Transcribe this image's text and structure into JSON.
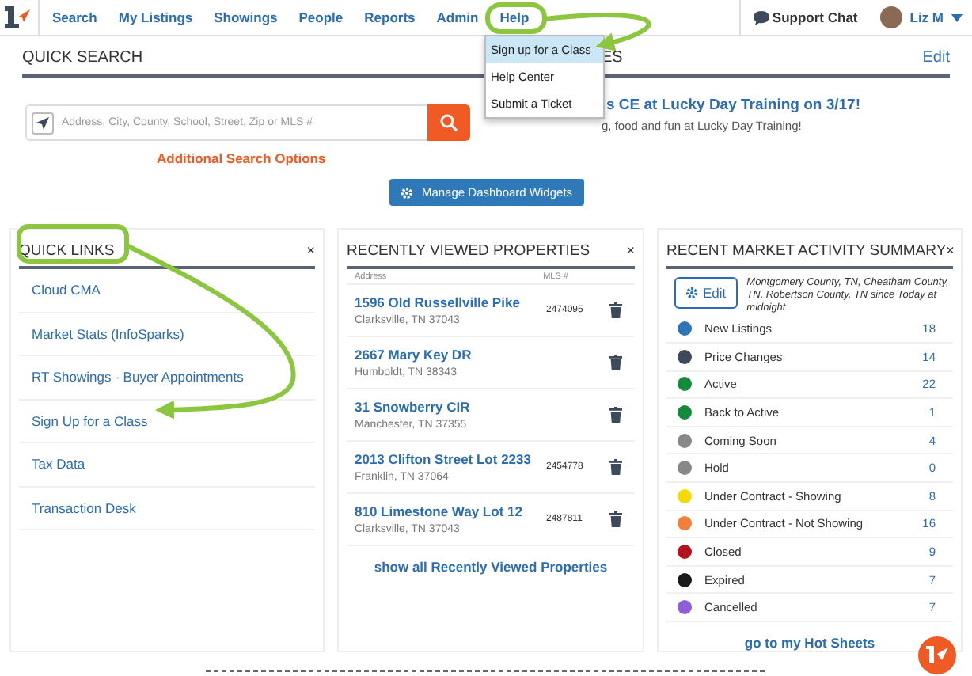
{
  "nav": {
    "items": [
      "Search",
      "My Listings",
      "Showings",
      "People",
      "Reports",
      "Admin",
      "Help"
    ],
    "support_chat": "Support Chat",
    "user": "Liz M"
  },
  "help_menu": [
    {
      "label": "Sign up for a Class",
      "selected": true
    },
    {
      "label": "Help Center",
      "selected": false
    },
    {
      "label": "Submit a Ticket",
      "selected": false
    }
  ],
  "quick_search": {
    "title": "QUICK SEARCH",
    "placeholder": "Address, City, County, School, Street, Zip or MLS #",
    "link": "Additional Search Options"
  },
  "updates": {
    "title": "ES",
    "edit": "Edit",
    "headline": "s CE at Lucky Day Training on 3/17!",
    "text": "g, food and fun at Lucky Day Training!"
  },
  "manage_button": "Manage Dashboard Widgets",
  "quick_links": {
    "title": "QUICK LINKS",
    "close": "×",
    "items": [
      "Cloud CMA",
      "Market Stats (InfoSparks)",
      "RT Showings - Buyer Appointments",
      "Sign Up for a Class",
      "Tax Data",
      "Transaction Desk"
    ]
  },
  "recently_viewed": {
    "title": "RECENTLY VIEWED PROPERTIES",
    "close": "×",
    "columns": [
      "Address",
      "MLS #"
    ],
    "rows": [
      {
        "address": "1596 Old Russellville Pike",
        "city": "Clarksville, TN 37043",
        "mls": "2474095"
      },
      {
        "address": "2667 Mary Key DR",
        "city": "Humboldt, TN 38343"
      },
      {
        "address": "31 Snowberry CIR",
        "city": "Manchester, TN 37355"
      },
      {
        "address": "2013 Clifton Street Lot 2233",
        "city": "Franklin, TN 37064",
        "mls": "2454778"
      },
      {
        "address": "810 Limestone Way Lot 12",
        "city": "Clarksville, TN 37043",
        "mls": "2487811"
      }
    ],
    "footer_link": "show all Recently Viewed Properties"
  },
  "market": {
    "title": "RECENT MARKET ACTIVITY SUMMARY",
    "close": "×",
    "edit_button": "Edit",
    "scope": "Montgomery County, TN, Cheatham County, TN, Robertson County, TN since Today at midnight",
    "rows": [
      {
        "label": "New Listings",
        "count": "18",
        "color": "#2e75b6"
      },
      {
        "label": "Price Changes",
        "count": "14",
        "color": "#3d4a5c"
      },
      {
        "label": "Active",
        "count": "22",
        "color": "#138a3c"
      },
      {
        "label": "Back to Active",
        "count": "1",
        "color": "#138a3c"
      },
      {
        "label": "Coming Soon",
        "count": "4",
        "color": "#888888"
      },
      {
        "label": "Hold",
        "count": "0",
        "color": "#888888"
      },
      {
        "label": "Under Contract - Showing",
        "count": "8",
        "color": "#f5d90a"
      },
      {
        "label": "Under Contract - Not Showing",
        "count": "16",
        "color": "#f07f3c"
      },
      {
        "label": "Closed",
        "count": "9",
        "color": "#b3121f"
      },
      {
        "label": "Expired",
        "count": "7",
        "color": "#1a1a1a"
      },
      {
        "label": "Cancelled",
        "count": "7",
        "color": "#8e5fd6"
      }
    ],
    "footer_link": "go to my Hot Sheets"
  }
}
